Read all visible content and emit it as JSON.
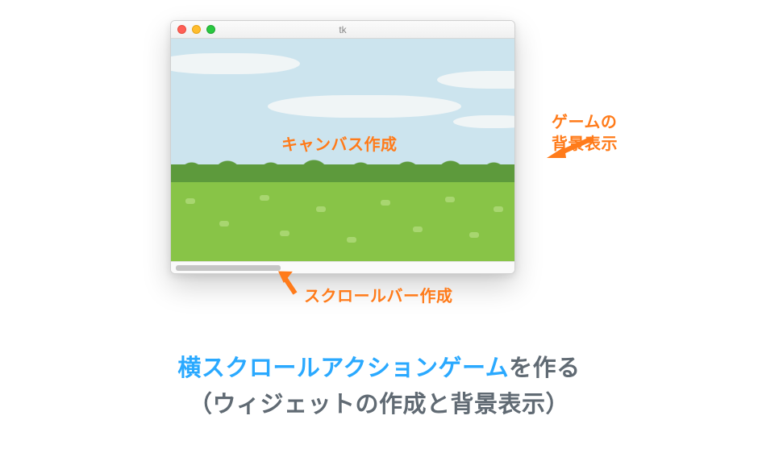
{
  "window": {
    "title": "tk"
  },
  "annotations": {
    "canvas_label": "キャンバス作成",
    "background_label_line1": "ゲームの",
    "background_label_line2": "背景表示",
    "scrollbar_label": "スクロールバー作成"
  },
  "headline": {
    "highlight": "横スクロールアクションゲーム",
    "line1_rest": "を作る",
    "line2": "（ウィジェットの作成と背景表示）"
  },
  "colors": {
    "accent_orange": "#ff7b1a",
    "accent_blue": "#2aa9ff",
    "text_gray": "#606a73",
    "sky": "#cce4ee",
    "grass": "#88c447",
    "hills": "#5d9a3c"
  }
}
